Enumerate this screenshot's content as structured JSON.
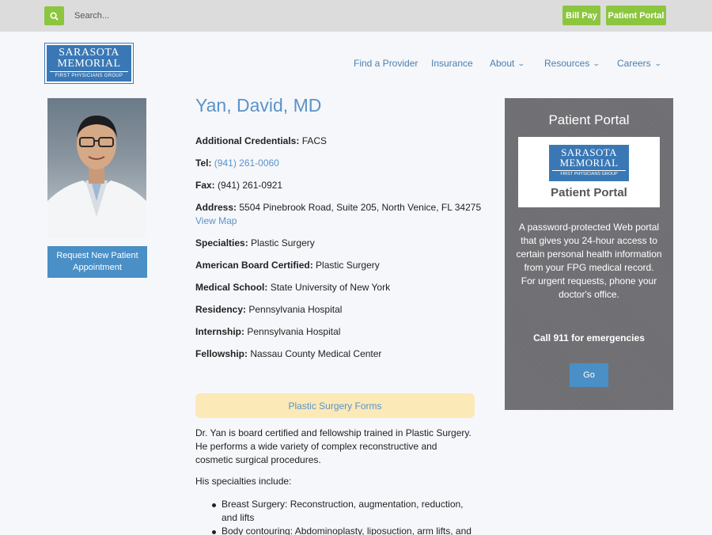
{
  "topbar": {
    "search_placeholder": "Search...",
    "bill_pay_label": "Bill Pay",
    "patient_portal_label": "Patient Portal"
  },
  "logo": {
    "line1": "SARASOTA",
    "line2": "MEMORIAL",
    "line3": "FIRST PHYSICIANS GROUP"
  },
  "nav": {
    "items": [
      {
        "label": "Find a Provider"
      },
      {
        "label": "Insurance"
      },
      {
        "label": "About"
      },
      {
        "label": "Resources"
      },
      {
        "label": "Careers"
      }
    ]
  },
  "sidebar": {
    "request_button_label": "Request New Patient Appointment"
  },
  "doctor": {
    "name": "Yan, David, MD",
    "credentials_label": "Additional Credentials:",
    "credentials": "FACS",
    "tel_label": "Tel:",
    "tel": "(941) 261-0060",
    "fax_label": "Fax:",
    "fax": "(941) 261-0921",
    "address_label": "Address:",
    "address": "5504 Pinebrook Road, Suite 205, North Venice, FL 34275",
    "view_map": "View Map",
    "specialties_label": "Specialties:",
    "specialties": "Plastic Surgery",
    "board_label": "American Board Certified:",
    "board": "Plastic Surgery",
    "school_label": "Medical School:",
    "school": "State University of New York",
    "residency_label": "Residency:",
    "residency": "Pennsylvania Hospital",
    "internship_label": "Internship:",
    "internship": "Pennsylvania Hospital",
    "fellowship_label": "Fellowship:",
    "fellowship": "Nassau County Medical Center"
  },
  "forms_button_label": "Plastic Surgery Forms",
  "bio": {
    "paragraph1": "Dr. Yan is board certified and fellowship trained in Plastic Surgery. He performs a wide variety of complex reconstructive and cosmetic surgical procedures.",
    "paragraph2": "His specialties include:",
    "bullets": [
      "Breast Surgery: Reconstruction, augmentation, reduction, and lifts",
      "Body contouring: Abdominoplasty, liposuction, arm lifts, and"
    ]
  },
  "portal_panel": {
    "title": "Patient Portal",
    "logo_line1": "SARASOTA",
    "logo_line2": "MEMORIAL",
    "logo_line3": "FIRST PHYSICIANS GROUP",
    "logo_caption": "Patient Portal",
    "description": "A password-protected Web portal that gives you 24-hour access to certain personal health information from your FPG medical record. For urgent requests, phone your doctor's office.",
    "emergency": "Call 911 for emergencies",
    "go_label": "Go"
  },
  "colors": {
    "accent_green": "#8cc63f",
    "link_blue": "#5a93c8",
    "button_blue": "#4a8fc6",
    "brand_blue": "#3a78b5",
    "panel_gray": "#6f6f73",
    "forms_yellow": "#fbe9b7"
  }
}
